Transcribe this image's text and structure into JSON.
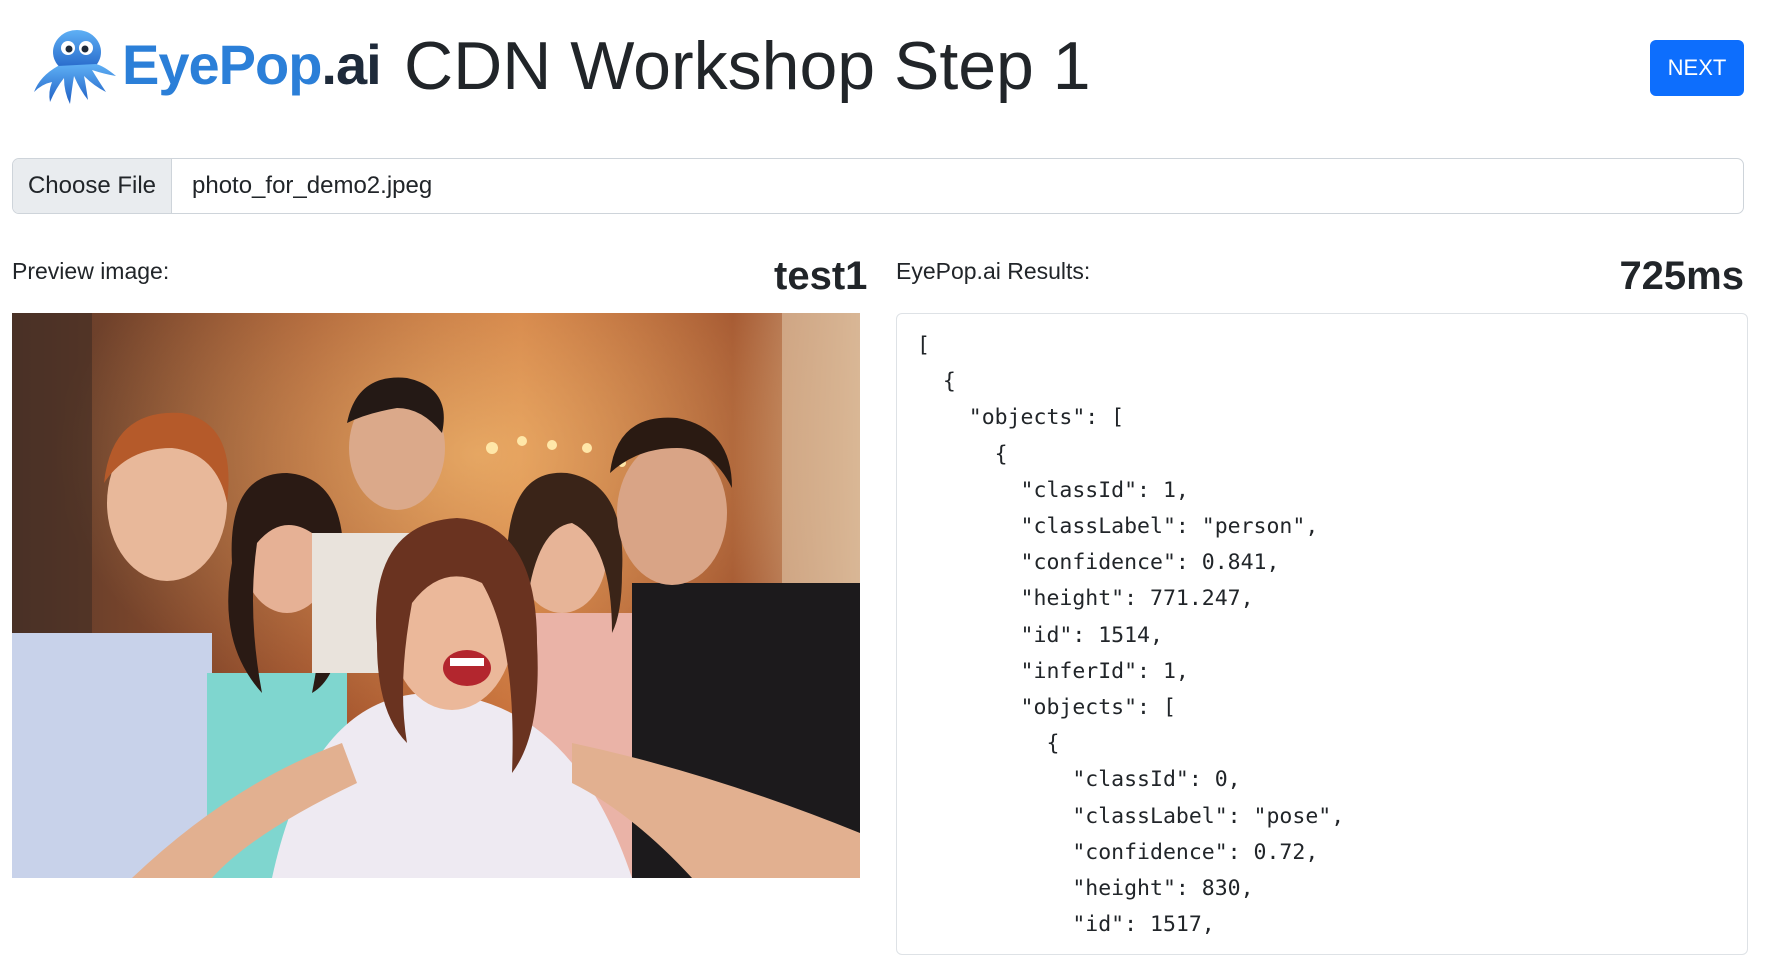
{
  "header": {
    "logo_brand": "EyePop",
    "logo_tld": ".ai",
    "title": "CDN Workshop Step 1",
    "next_label": "NEXT"
  },
  "file_input": {
    "button_label": "Choose File",
    "file_name": "photo_for_demo2.jpeg"
  },
  "preview": {
    "label": "Preview image:",
    "name": "test1"
  },
  "results": {
    "label": "EyePop.ai Results:",
    "timing": "725ms",
    "json_text": "[\n  {\n    \"objects\": [\n      {\n        \"classId\": 1,\n        \"classLabel\": \"person\",\n        \"confidence\": 0.841,\n        \"height\": 771.247,\n        \"id\": 1514,\n        \"inferId\": 1,\n        \"objects\": [\n          {\n            \"classId\": 0,\n            \"classLabel\": \"pose\",\n            \"confidence\": 0.72,\n            \"height\": 830,\n            \"id\": 1517,"
  },
  "colors": {
    "primary": "#0d6efd",
    "brand_blue": "#2b7fd8"
  }
}
